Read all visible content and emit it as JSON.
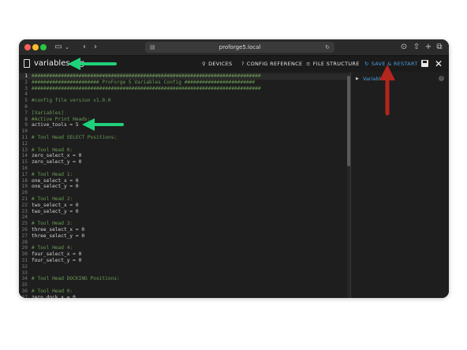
{
  "browser": {
    "address": "proforge5.local"
  },
  "appbar": {
    "filename": "variables.cfg",
    "nav": [
      {
        "glyph": "⚲",
        "label": "DEVICES"
      },
      {
        "glyph": "?",
        "label": "CONFIG REFERENCE"
      },
      {
        "glyph": "≡",
        "label": "FILE STRUCTURE"
      },
      {
        "glyph": "↻",
        "label": "SAVE & RESTART"
      }
    ]
  },
  "editor": {
    "lines": [
      {
        "n": "1",
        "text": "##############################################################################",
        "kind": "comment"
      },
      {
        "n": "2",
        "text": "####################### ProForge 5 Variables Config ########################",
        "kind": "comment"
      },
      {
        "n": "3",
        "text": "##############################################################################",
        "kind": "comment"
      },
      {
        "n": "4",
        "text": "",
        "kind": "key"
      },
      {
        "n": "5",
        "text": "#config file version v1.0.0",
        "kind": "comment"
      },
      {
        "n": "6",
        "text": "",
        "kind": "key"
      },
      {
        "n": "7",
        "text": "[Variables]",
        "kind": "section"
      },
      {
        "n": "8",
        "text": "#Active Print Heads:",
        "kind": "comment"
      },
      {
        "n": "9",
        "text": "active_tools = 5",
        "kind": "key"
      },
      {
        "n": "10",
        "text": "",
        "kind": "key"
      },
      {
        "n": "11",
        "text": "# Tool Head SELECT Positions:",
        "kind": "comment"
      },
      {
        "n": "12",
        "text": "",
        "kind": "key"
      },
      {
        "n": "13",
        "text": "# Tool Head 0:",
        "kind": "comment"
      },
      {
        "n": "14",
        "text": "zero_select_x = 0",
        "kind": "key"
      },
      {
        "n": "15",
        "text": "zero_select_y = 0",
        "kind": "key"
      },
      {
        "n": "16",
        "text": "",
        "kind": "key"
      },
      {
        "n": "17",
        "text": "# Tool Head 1:",
        "kind": "comment"
      },
      {
        "n": "18",
        "text": "one_select_x = 0",
        "kind": "key"
      },
      {
        "n": "19",
        "text": "one_select_y = 0",
        "kind": "key"
      },
      {
        "n": "20",
        "text": "",
        "kind": "key"
      },
      {
        "n": "21",
        "text": "# Tool Head 2:",
        "kind": "comment"
      },
      {
        "n": "22",
        "text": "two_select_x = 0",
        "kind": "key"
      },
      {
        "n": "23",
        "text": "two_select_y = 0",
        "kind": "key"
      },
      {
        "n": "24",
        "text": "",
        "kind": "key"
      },
      {
        "n": "25",
        "text": "# Tool Head 3:",
        "kind": "comment"
      },
      {
        "n": "26",
        "text": "three_select_x = 0",
        "kind": "key"
      },
      {
        "n": "27",
        "text": "three_select_y = 0",
        "kind": "key"
      },
      {
        "n": "28",
        "text": "",
        "kind": "key"
      },
      {
        "n": "29",
        "text": "# Tool Head 4:",
        "kind": "comment"
      },
      {
        "n": "30",
        "text": "four_select_x = 0",
        "kind": "key"
      },
      {
        "n": "31",
        "text": "four_select_y = 0",
        "kind": "key"
      },
      {
        "n": "32",
        "text": "",
        "kind": "key"
      },
      {
        "n": "33",
        "text": "",
        "kind": "key"
      },
      {
        "n": "34",
        "text": "# Tool Head DOCKING Positions:",
        "kind": "comment"
      },
      {
        "n": "35",
        "text": "",
        "kind": "key"
      },
      {
        "n": "36",
        "text": "# Tool Head 0:",
        "kind": "comment"
      },
      {
        "n": "37",
        "text": "zero_dock_x = 0",
        "kind": "key"
      }
    ]
  },
  "sidepanel": {
    "tree_item": "Variables"
  },
  "colors": {
    "annotation_green": "#1fd17a",
    "annotation_red": "#b3261e",
    "accent_blue": "#4a9fe0"
  }
}
